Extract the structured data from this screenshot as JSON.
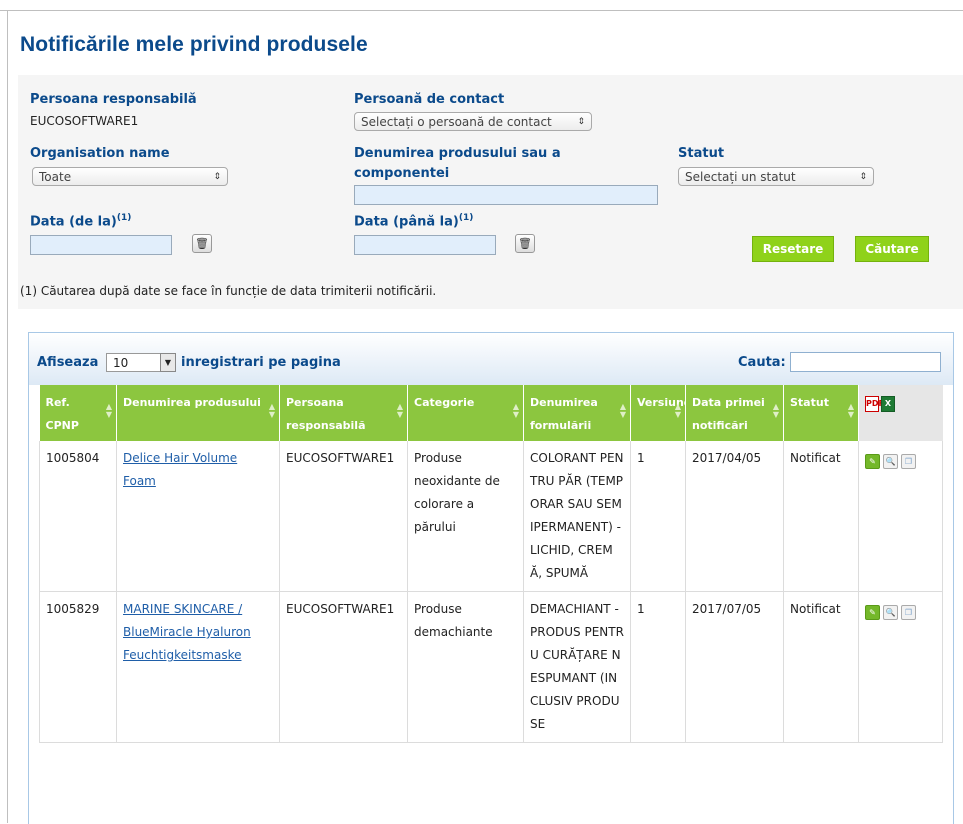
{
  "page_title": "Notificările mele privind produsele",
  "filters": {
    "responsible_label": "Persoana responsabilă",
    "responsible_value": "EUCOSOFTWARE1",
    "contact_label": "Persoană de contact",
    "contact_select": "Selectați o persoană de contact",
    "org_label": "Organisation name",
    "org_select": "Toate",
    "product_label_1": "Denumirea produsului sau a",
    "product_label_2": "componentei",
    "status_label": "Statut",
    "status_select": "Selectați un statut",
    "date_from_label": "Data (de la)",
    "date_to_label": "Data (până la)",
    "footnote_mark": "(1)",
    "reset_label": "Resetare",
    "search_label": "Căutare",
    "note": "(1) Căutarea după date se face în funcție de data trimiterii notificării."
  },
  "list": {
    "show_label": "Afiseaza",
    "page_size": "10",
    "per_page_label": "inregistrari pe pagina",
    "search_label": "Cauta:",
    "columns": [
      "Ref. CPNP",
      "Denumirea produsului",
      "Persoana responsabilă",
      "Categorie",
      "Denumirea formulării",
      "Versiune",
      "Data primei notificări",
      "Statut"
    ],
    "rows": [
      {
        "ref": "1005804",
        "product": "Delice Hair Volume Foam",
        "responsible": "EUCOSOFTWARE1",
        "category": "Produse neoxidante de colorare a părului",
        "formulation": "COLORANT PENTRU PĂR (TEMPORAR SAU SEMIPERMANENT) - LICHID, CREMĂ, SPUMĂ",
        "version": "1",
        "first_date": "2017/04/05",
        "status": "Notificat"
      },
      {
        "ref": "1005829",
        "product": "MARINE SKINCARE / BlueMiracle Hyaluron Feuchtigkeitsmaske",
        "responsible": "EUCOSOFTWARE1",
        "category": "Produse demachiante",
        "formulation": "DEMACHIANT - PRODUS PENTRU CURĂȚARE NESPUMANT (INCLUSIV PRODUSE",
        "version": "1",
        "first_date": "2017/07/05",
        "status": "Notificat"
      }
    ]
  },
  "colors": {
    "title": "#0b4a8b",
    "header_green": "#8cc63f",
    "button_green": "#8fd21a",
    "link": "#1f5ea8"
  }
}
